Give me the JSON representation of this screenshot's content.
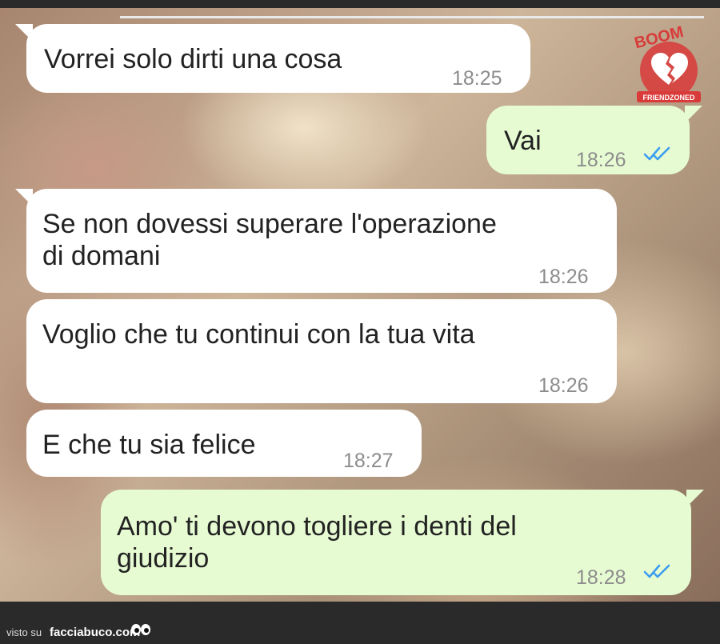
{
  "chat": {
    "messages": [
      {
        "direction": "incoming",
        "text": "Vorrei solo dirti una cosa",
        "time": "18:25"
      },
      {
        "direction": "outgoing",
        "text": "Vai",
        "time": "18:26",
        "status": "read"
      },
      {
        "direction": "incoming",
        "text": "Se non dovessi superare l'operazione\ndi domani",
        "time": "18:26"
      },
      {
        "direction": "incoming",
        "text": "Voglio che tu continui con la tua vita",
        "time": "18:26"
      },
      {
        "direction": "incoming",
        "text": "E che tu sia felice",
        "time": "18:27"
      },
      {
        "direction": "outgoing",
        "text": "Amo' ti devono togliere i denti del\ngiudizio",
        "time": "18:28",
        "status": "read"
      }
    ]
  },
  "watermark": {
    "line1": "BOOM",
    "line2": "FRIENDZONED"
  },
  "footer": {
    "label": "visto su",
    "site": "facciabuco.com"
  },
  "colors": {
    "incoming_bubble": "#ffffff",
    "outgoing_bubble": "#e6fbd2",
    "read_ticks": "#3b9df0",
    "logo_red": "#d93a3a"
  },
  "icons": {
    "read_receipt": "double-check-icon",
    "watermark": "broken-heart-icon",
    "footer_logo": "eyes-icon"
  }
}
